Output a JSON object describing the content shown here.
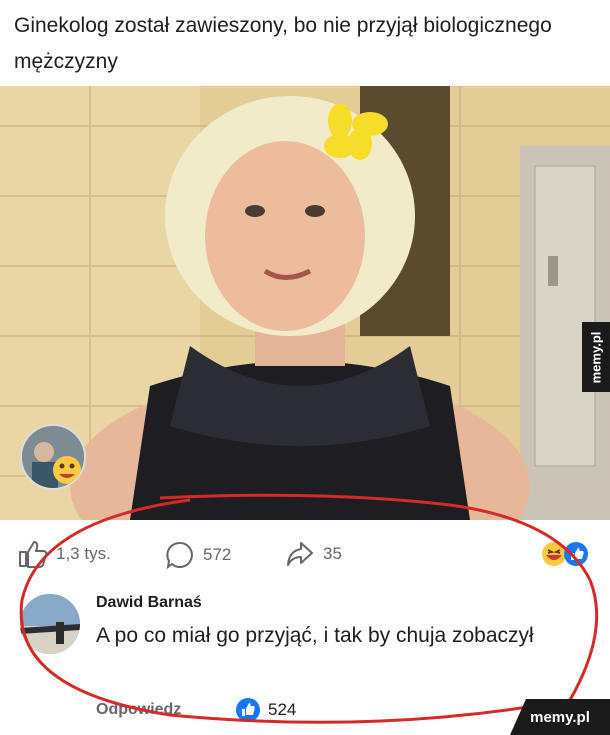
{
  "post": {
    "text": "Ginekolog został zawieszony, bo nie przyjął biologicznego mężczyzny"
  },
  "stats": {
    "likes": "1,3 tys.",
    "comments": "572",
    "shares": "35"
  },
  "comment": {
    "author": "Dawid Barnaś",
    "text": "A po co miał go przyjąć, i tak by chuja zobaczył",
    "reply_label": "Odpowiedz",
    "like_count": "524"
  },
  "watermark": {
    "side": "memy.pl",
    "corner": "memy.pl"
  },
  "colors": {
    "facebook_blue": "#1877f2",
    "annotation_red": "#d42a2a"
  }
}
